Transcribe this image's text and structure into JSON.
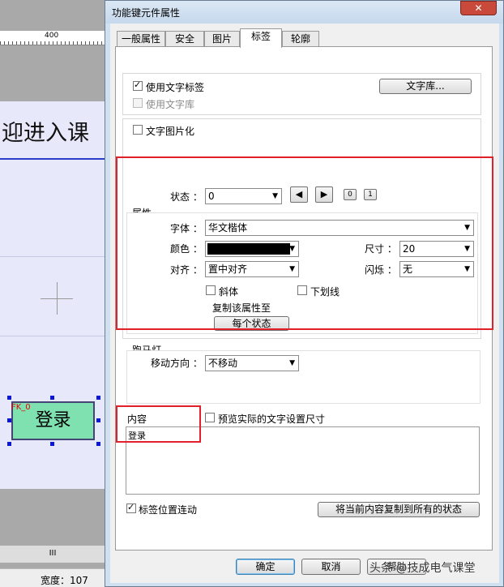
{
  "background": {
    "ruler_mark": "400",
    "welcome_text": "迎进入课",
    "button_id": "FK_0",
    "button_text": "登录",
    "scroll_indicator": "III",
    "status_width": "宽度：107"
  },
  "dialog": {
    "title": "功能键元件属性",
    "close_glyph": "✕",
    "tabs": [
      {
        "label": "一般属性"
      },
      {
        "label": "安全"
      },
      {
        "label": "图片"
      },
      {
        "label": "标签"
      },
      {
        "label": "轮廓"
      }
    ],
    "use_text_label": "使用文字标签",
    "use_text_library": "使用文字库",
    "text_library_button": "文字库...",
    "text_picturize": "文字图片化",
    "state_label": "状态 ：",
    "state_value": "0",
    "state_prev_icon": "◀",
    "state_next_icon": "▶",
    "state_btn_0": "0",
    "state_btn_1": "1",
    "attributes_title": "属性",
    "font_label": "字体 ：",
    "font_value": "华文楷体",
    "color_label": "颜色 ：",
    "color_value": "#000000",
    "size_label": "尺寸 ：",
    "size_value": "20",
    "align_label": "对齐 ：",
    "align_value": "置中对齐",
    "blink_label": "闪烁 ：",
    "blink_value": "无",
    "italic_label": "斜体",
    "underline_label": "下划线",
    "copy_attr_title": "复制该属性至",
    "each_state_button": "每个状态",
    "marquee_title": "跑马灯",
    "move_direction_label": "移动方向 ：",
    "move_direction_value": "不移动",
    "content_title": "内容",
    "preview_label": "预览实际的文字设置尺寸",
    "content_text": "登录",
    "link_position_label": "标签位置连动",
    "copy_all_button": "将当前内容复制到所有的状态",
    "ok_button": "确定",
    "cancel_button": "取消",
    "help_button": "帮助"
  },
  "watermark": "头条 @技成电气课堂",
  "highlight_color": "#e0202a"
}
